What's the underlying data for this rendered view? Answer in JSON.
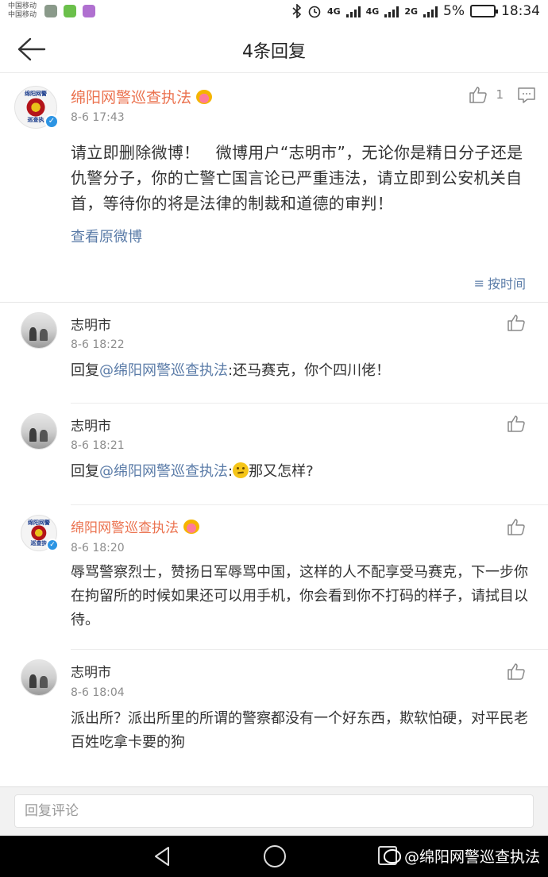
{
  "status_bar": {
    "carrier_line1": "中国移动",
    "carrier_line2": "中国移动",
    "net1": "4G",
    "net2": "4G",
    "net3": "2G",
    "battery": "5%",
    "time": "18:34"
  },
  "nav": {
    "title": "4条回复"
  },
  "main_post": {
    "author": "绵阳网警巡查执法",
    "avatar_text_top": "绵阳网警",
    "avatar_text_bottom": "巡查执",
    "time": "8-6 17:43",
    "likes": "1",
    "content": "请立即删除微博！　微博用户“志明市”，无论你是精日分子还是仇警分子，你的亡警亡国言论已严重违法，请立即到公安机关自首，等待你的将是法律的制裁和道德的审判！",
    "view_original": "查看原微博",
    "sort_label": "按时间",
    "sort_icon": "≡"
  },
  "replies": [
    {
      "name": "志明市",
      "time": "8-6 18:22",
      "prefix": "回复",
      "mention": "@绵阳网警巡查执法",
      "text": ":还马赛克，你个四川佬！"
    },
    {
      "name": "志明市",
      "time": "8-6 18:21",
      "prefix": "回复",
      "mention": "@绵阳网警巡查执法",
      "text": ":",
      "text_after_emoji": "那又怎样?"
    },
    {
      "name": "绵阳网警巡查执法",
      "avatar_text_top": "绵阳网警",
      "avatar_text_bottom": "巡查执",
      "time": "8-6 18:20",
      "text": "辱骂警察烈士，赞扬日军辱骂中国，这样的人不配享受马赛克，下一步你在拘留所的时候如果还可以用手机，你会看到你不打码的样子，请拭目以待。"
    },
    {
      "name": "志明市",
      "time": "8-6 18:04",
      "text": "派出所？派出所里的所谓的警察都没有一个好东西，欺软怕硬，对平民老百姓吃拿卡要的狗"
    }
  ],
  "input": {
    "placeholder": "回复评论"
  },
  "watermark": {
    "text": "@绵阳网警巡查执法"
  },
  "colors": {
    "accent_orange": "#eb7350",
    "link_blue": "#5b7ca8",
    "verified_blue": "#2c94e3"
  }
}
